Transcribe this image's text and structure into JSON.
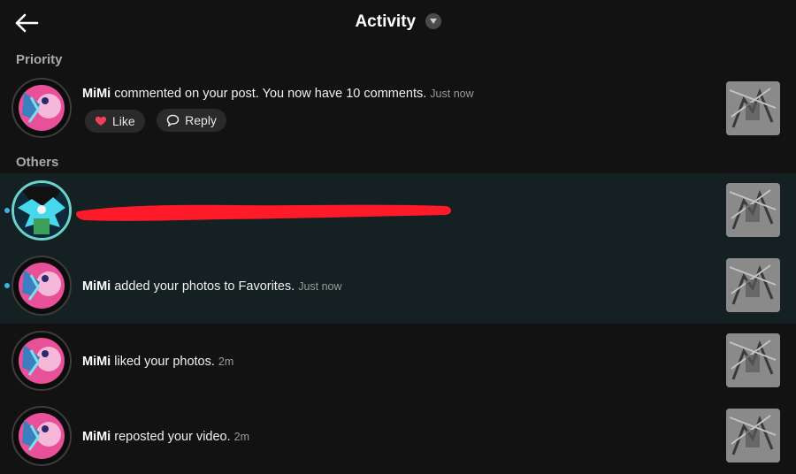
{
  "header": {
    "title": "Activity"
  },
  "sections": {
    "priority": "Priority",
    "others": "Others"
  },
  "priority_item": {
    "user": "MiMi",
    "text": " commented on your post. You now have 10 comments.",
    "time": "Just now",
    "like_label": "Like",
    "reply_label": "Reply"
  },
  "others": [
    {
      "user": "MiMi",
      "text": " added your photos to Favorites.",
      "time": "Just now",
      "unread": true
    },
    {
      "user": "MiMi",
      "text": " liked your photos.",
      "time": "2m",
      "unread": false
    },
    {
      "user": "MiMi",
      "text": " reposted your video.",
      "time": "2m",
      "unread": false
    }
  ],
  "colors": {
    "background": "#121212",
    "unread_row": "#142022",
    "unread_dot": "#38b4e8",
    "like_heart": "#f0405a",
    "redaction": "#ff1a2a"
  },
  "icons": [
    "back-arrow-icon",
    "caret-down-icon",
    "heart-icon",
    "comment-bubble-icon"
  ]
}
